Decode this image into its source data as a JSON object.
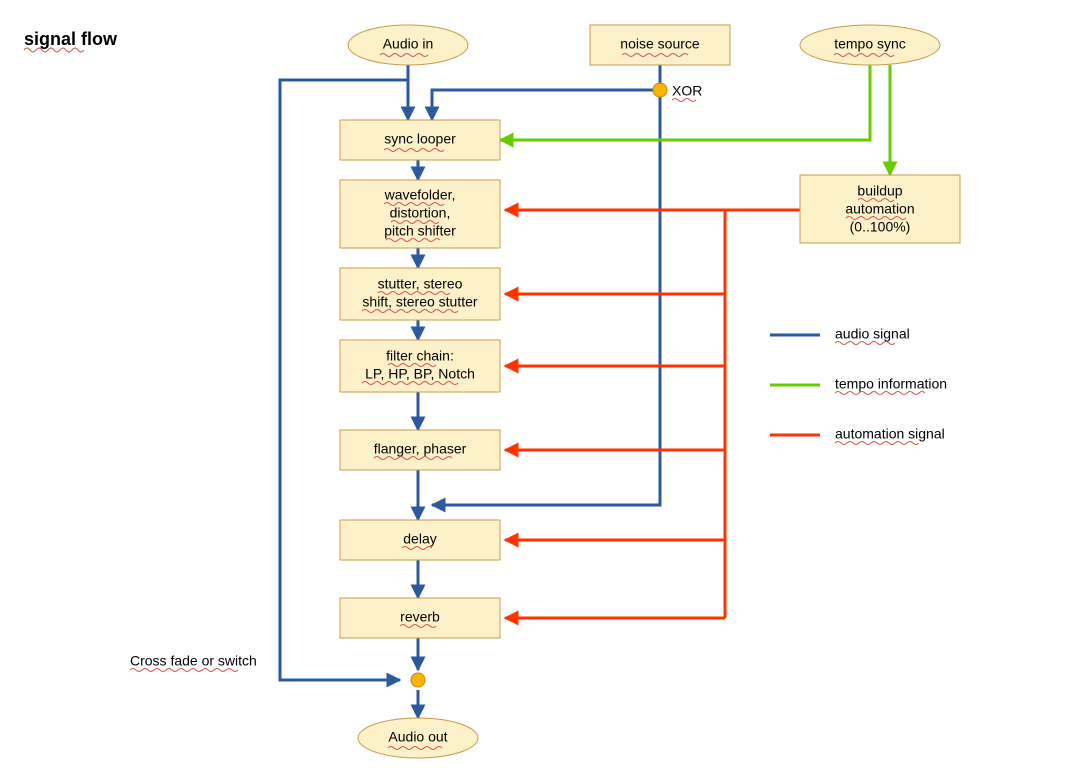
{
  "title": "signal flow",
  "nodes": {
    "audio_in": "Audio in",
    "noise_source": "noise source",
    "tempo_sync": "tempo sync",
    "sync_looper": "sync looper",
    "wavefolder_l1": "wavefolder,",
    "wavefolder_l2": "distortion,",
    "wavefolder_l3": "pitch shifter",
    "stutter_l1": "stutter, stereo",
    "stutter_l2": "shift, stereo stutter",
    "filter_l1": "filter chain:",
    "filter_l2": "LP, HP, BP, Notch",
    "flanger": "flanger, phaser",
    "delay": "delay",
    "reverb": "reverb",
    "audio_out": "Audio out",
    "buildup_l1": "buildup",
    "buildup_l2": "automation",
    "buildup_l3": "(0..100%)"
  },
  "annotations": {
    "xor": "XOR",
    "crossfade": "Cross fade or switch"
  },
  "legend": {
    "audio": "audio signal",
    "tempo": "tempo information",
    "automation": "automation signal"
  },
  "colors": {
    "audio": "#2d5a9e",
    "tempo": "#66cc00",
    "automation": "#ff3300",
    "node_fill": "#fdf1ca",
    "node_stroke": "#c69c4a",
    "junction": "#f9b300"
  },
  "chart_data": {
    "type": "flowchart",
    "nodes": [
      {
        "id": "audio_in",
        "label": "Audio in",
        "shape": "ellipse"
      },
      {
        "id": "noise_source",
        "label": "noise source",
        "shape": "rect"
      },
      {
        "id": "tempo_sync",
        "label": "tempo sync",
        "shape": "ellipse"
      },
      {
        "id": "sync_looper",
        "label": "sync looper",
        "shape": "rect"
      },
      {
        "id": "wavefolder",
        "label": "wavefolder, distortion, pitch shifter",
        "shape": "rect"
      },
      {
        "id": "stutter",
        "label": "stutter, stereo shift, stereo stutter",
        "shape": "rect"
      },
      {
        "id": "filter",
        "label": "filter chain: LP, HP, BP, Notch",
        "shape": "rect"
      },
      {
        "id": "flanger",
        "label": "flanger, phaser",
        "shape": "rect"
      },
      {
        "id": "delay",
        "label": "delay",
        "shape": "rect"
      },
      {
        "id": "reverb",
        "label": "reverb",
        "shape": "rect"
      },
      {
        "id": "audio_out",
        "label": "Audio out",
        "shape": "ellipse"
      },
      {
        "id": "buildup",
        "label": "buildup automation (0..100%)",
        "shape": "rect"
      }
    ],
    "edges": [
      {
        "from": "audio_in",
        "to": "sync_looper",
        "kind": "audio"
      },
      {
        "from": "noise_source",
        "to": "sync_looper",
        "kind": "audio",
        "via": "XOR"
      },
      {
        "from": "noise_source",
        "to": "flanger_below",
        "kind": "audio"
      },
      {
        "from": "sync_looper",
        "to": "wavefolder",
        "kind": "audio"
      },
      {
        "from": "wavefolder",
        "to": "stutter",
        "kind": "audio"
      },
      {
        "from": "stutter",
        "to": "filter",
        "kind": "audio"
      },
      {
        "from": "filter",
        "to": "flanger",
        "kind": "audio"
      },
      {
        "from": "flanger",
        "to": "delay",
        "kind": "audio"
      },
      {
        "from": "delay",
        "to": "reverb",
        "kind": "audio"
      },
      {
        "from": "reverb",
        "to": "audio_out",
        "kind": "audio",
        "via": "crossfade"
      },
      {
        "from": "audio_in",
        "to": "audio_out",
        "kind": "audio",
        "note": "bypass (Cross fade or switch)"
      },
      {
        "from": "tempo_sync",
        "to": "sync_looper",
        "kind": "tempo"
      },
      {
        "from": "tempo_sync",
        "to": "buildup",
        "kind": "tempo"
      },
      {
        "from": "buildup",
        "to": "wavefolder",
        "kind": "automation"
      },
      {
        "from": "buildup",
        "to": "stutter",
        "kind": "automation"
      },
      {
        "from": "buildup",
        "to": "filter",
        "kind": "automation"
      },
      {
        "from": "buildup",
        "to": "flanger",
        "kind": "automation"
      },
      {
        "from": "buildup",
        "to": "delay",
        "kind": "automation"
      },
      {
        "from": "buildup",
        "to": "reverb",
        "kind": "automation"
      }
    ],
    "legend": [
      {
        "color": "#2d5a9e",
        "label": "audio signal"
      },
      {
        "color": "#66cc00",
        "label": "tempo information"
      },
      {
        "color": "#ff3300",
        "label": "automation signal"
      }
    ]
  }
}
